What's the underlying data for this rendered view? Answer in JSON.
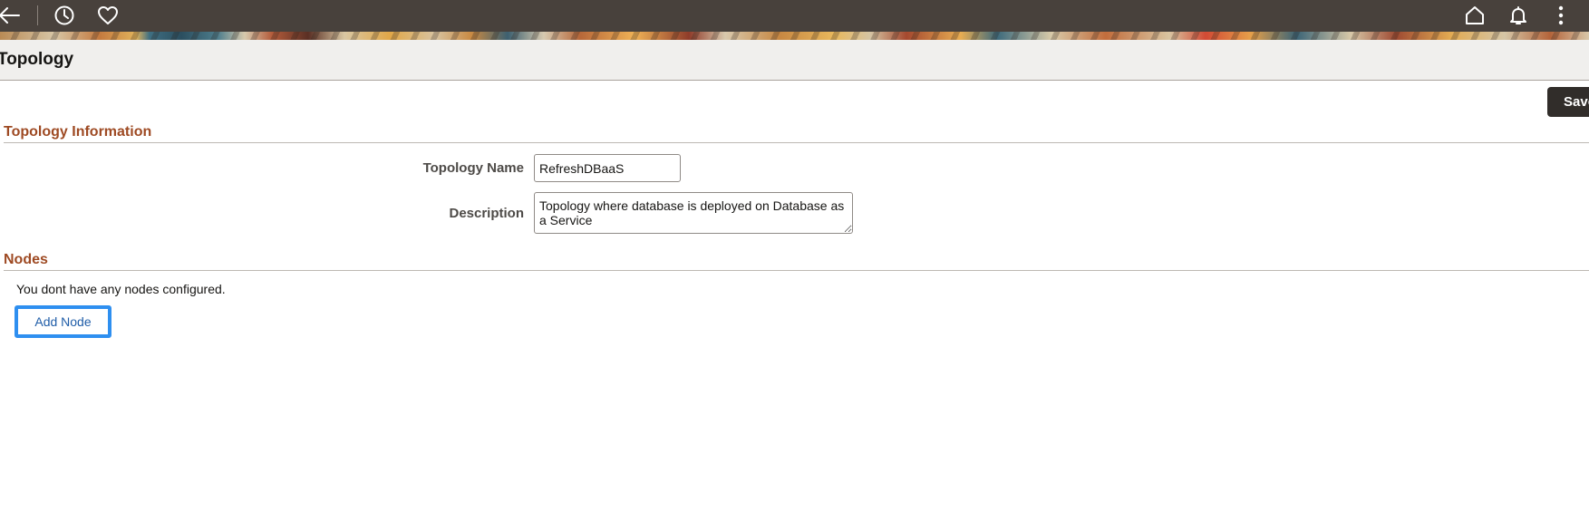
{
  "nav": {
    "back_icon": "back-arrow-icon",
    "recent_icon": "clock-icon",
    "favorites_icon": "heart-icon",
    "home_icon": "home-icon",
    "notifications_icon": "bell-icon",
    "actions_icon": "kebab-menu-icon"
  },
  "page": {
    "title": "Topology"
  },
  "toolbar": {
    "save_label": "Save"
  },
  "topology_info": {
    "section_title": "Topology Information",
    "name_label": "Topology Name",
    "name_value": "RefreshDBaaS",
    "description_label": "Description",
    "description_value": "Topology where database is deployed on Database as a Service"
  },
  "nodes": {
    "section_title": "Nodes",
    "empty_message": "You dont have any nodes configured.",
    "add_node_label": "Add Node"
  },
  "colors": {
    "banner_bar": "#48413c",
    "section_header": "#9e4a23",
    "save_button_bg": "#312d2a",
    "focus_ring": "#2e8ff0",
    "link_text": "#1f5da8"
  }
}
